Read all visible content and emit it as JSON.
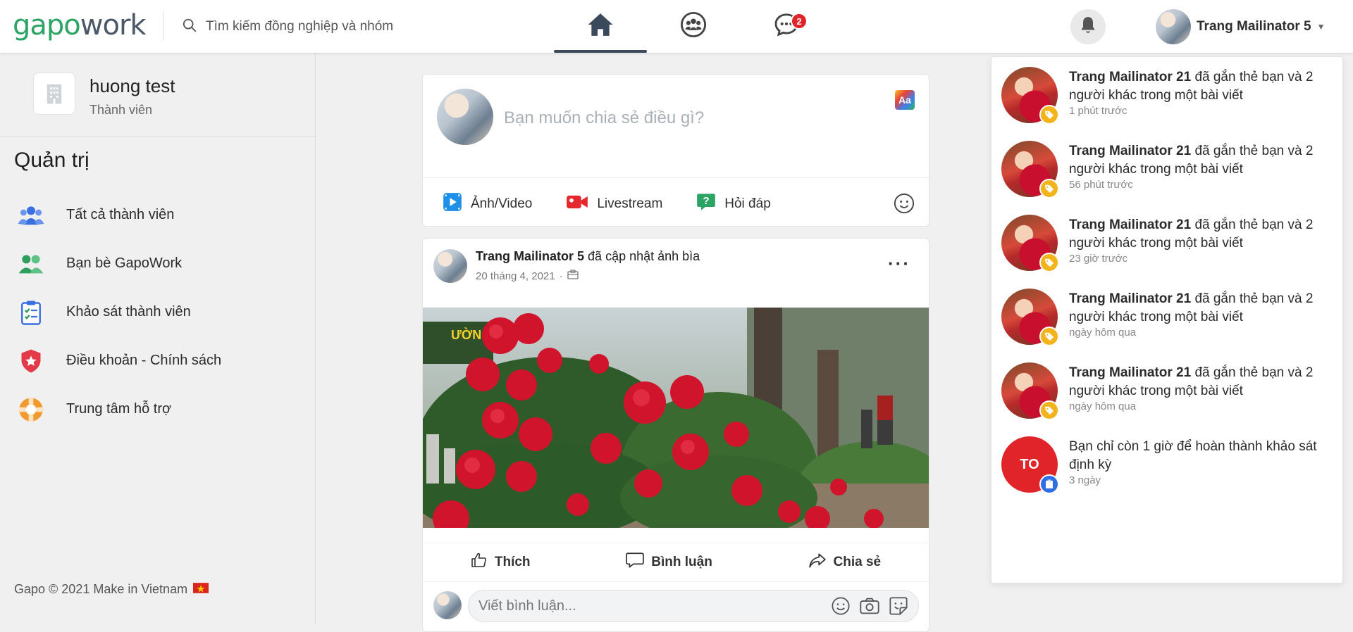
{
  "header": {
    "logo_part1": "gapo",
    "logo_part2": "work",
    "search_placeholder": "Tìm kiếm đồng nghiệp và nhóm",
    "chat_badge": "2",
    "user_name": "Trang Mailinator 5"
  },
  "sidebar": {
    "org_name": "huong test",
    "org_role": "Thành viên",
    "admin_title": "Quản trị",
    "items": [
      {
        "label": "Tất cả thành viên",
        "icon": "users-icon"
      },
      {
        "label": "Bạn bè GapoWork",
        "icon": "friends-icon"
      },
      {
        "label": "Khảo sát thành viên",
        "icon": "survey-icon"
      },
      {
        "label": "Điều khoản - Chính sách",
        "icon": "shield-star-icon"
      },
      {
        "label": "Trung tâm hỗ trợ",
        "icon": "lifebuoy-icon"
      }
    ],
    "footer": "Gapo © 2021 Make in Vietnam"
  },
  "composer": {
    "placeholder": "Bạn muốn chia sẻ điều gì?",
    "aa_label": "Aa",
    "actions": [
      "Ảnh/Video",
      "Livestream",
      "Hỏi đáp"
    ]
  },
  "post": {
    "author": "Trang Mailinator 5",
    "action": "đã cập nhật ảnh bìa",
    "date": "20 tháng 4, 2021",
    "like": "Thích",
    "comment": "Bình luận",
    "share": "Chia sẻ",
    "comment_placeholder": "Viết bình luận..."
  },
  "notifications": [
    {
      "actor": "Trang Mailinator 21",
      "text": "đã gắn thẻ bạn và 2 người khác trong một bài viết",
      "time": "1 phút trước"
    },
    {
      "actor": "Trang Mailinator 21",
      "text": "đã gắn thẻ bạn và 2 người khác trong một bài viết",
      "time": "56 phút trước"
    },
    {
      "actor": "Trang Mailinator 21",
      "text": "đã gắn thẻ bạn và 2 người khác trong một bài viết",
      "time": "23 giờ trước"
    },
    {
      "actor": "Trang Mailinator 21",
      "text": "đã gắn thẻ bạn và 2 người khác trong một bài viết",
      "time": "ngày hôm qua"
    },
    {
      "actor": "Trang Mailinator 21",
      "text": "đã gắn thẻ bạn và 2 người khác trong một bài viết",
      "time": "ngày hôm qua"
    },
    {
      "initials": "TO",
      "text": "Bạn chỉ còn 1 giờ để hoàn thành khảo sát định kỳ",
      "time": "3 ngày"
    }
  ],
  "colors": {
    "brand_green": "#2ba464",
    "brand_dark": "#4a5868",
    "badge_red": "#e0242a",
    "tag_yellow": "#f3b31b"
  }
}
